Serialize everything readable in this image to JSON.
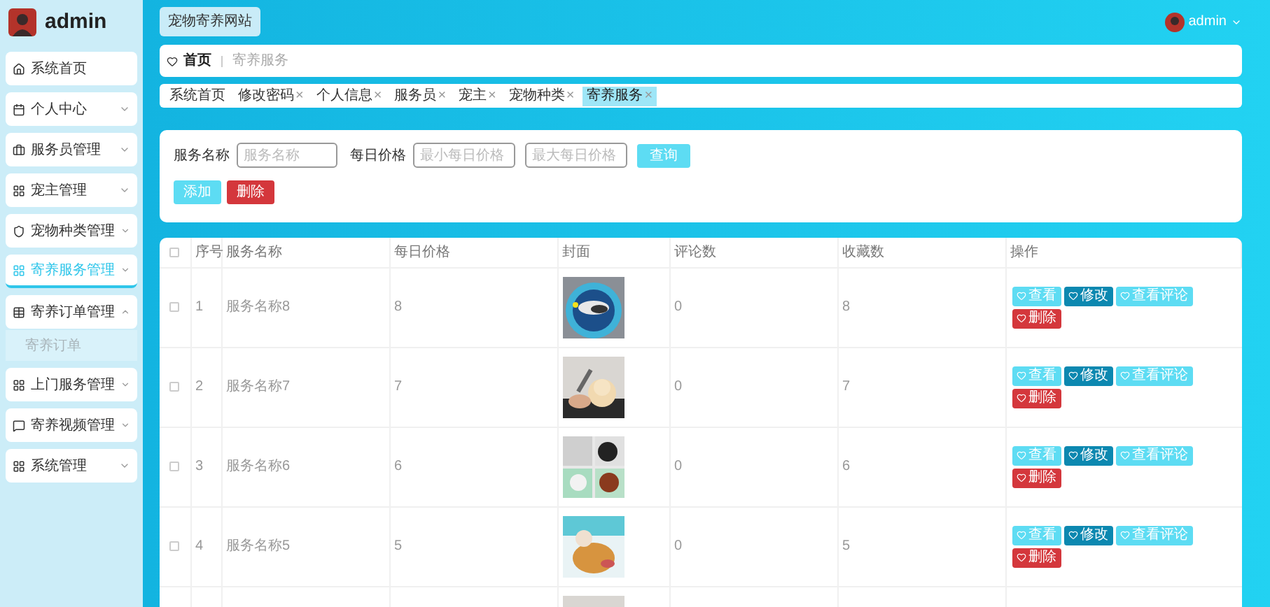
{
  "sidebar": {
    "user": "admin",
    "items": [
      {
        "label": "系统首页",
        "expandable": false,
        "selected": false
      },
      {
        "label": "个人中心",
        "expandable": true,
        "selected": false,
        "expanded": false
      },
      {
        "label": "服务员管理",
        "expandable": true,
        "selected": false,
        "expanded": false
      },
      {
        "label": "宠主管理",
        "expandable": true,
        "selected": false,
        "expanded": false
      },
      {
        "label": "宠物种类管理",
        "expandable": true,
        "selected": false,
        "expanded": false
      },
      {
        "label": "寄养服务管理",
        "expandable": true,
        "selected": true,
        "expanded": false
      },
      {
        "label": "寄养订单管理",
        "expandable": true,
        "selected": false,
        "expanded": true,
        "children": [
          {
            "label": "寄养订单",
            "selected": false
          }
        ]
      },
      {
        "label": "上门服务管理",
        "expandable": true,
        "selected": false,
        "expanded": false
      },
      {
        "label": "寄养视频管理",
        "expandable": true,
        "selected": false,
        "expanded": false
      },
      {
        "label": "系统管理",
        "expandable": true,
        "selected": false,
        "expanded": false
      }
    ]
  },
  "header": {
    "site_button": "宠物寄养网站",
    "user": "admin"
  },
  "breadcrumb": [
    "首页",
    "寄养服务"
  ],
  "tabs": [
    {
      "label": "系统首页",
      "closable": false,
      "selected": false
    },
    {
      "label": "修改密码",
      "closable": true,
      "selected": false
    },
    {
      "label": "个人信息",
      "closable": true,
      "selected": false
    },
    {
      "label": "服务员",
      "closable": true,
      "selected": false
    },
    {
      "label": "宠主",
      "closable": true,
      "selected": false
    },
    {
      "label": "宠物种类",
      "closable": true,
      "selected": false
    },
    {
      "label": "寄养服务",
      "closable": true,
      "selected": true
    }
  ],
  "close_mark": "×",
  "search": {
    "name_label": "服务名称",
    "name_placeholder": "服务名称",
    "price_label": "每日价格",
    "min_placeholder": "最小每日价格",
    "max_placeholder": "最大每日价格",
    "search_button": "查询",
    "add_button": "添加",
    "delete_button": "删除"
  },
  "table": {
    "columns": [
      "序号",
      "服务名称",
      "每日价格",
      "封面",
      "评论数",
      "收藏数",
      "操作"
    ],
    "all_checked": false,
    "rows": [
      {
        "index": "1",
        "name": "服务名称8",
        "price": "8",
        "comments": "0",
        "favorites": "8",
        "checked": false,
        "actions": [
          {
            "label": "查看",
            "kind": "view"
          },
          {
            "label": "修改",
            "kind": "edit"
          },
          {
            "label": "查看评论",
            "kind": "view"
          },
          {
            "label": "删除",
            "kind": "delete"
          }
        ]
      },
      {
        "index": "2",
        "name": "服务名称7",
        "price": "7",
        "comments": "0",
        "favorites": "7",
        "checked": false,
        "actions": [
          {
            "label": "查看",
            "kind": "view"
          },
          {
            "label": "修改",
            "kind": "edit"
          },
          {
            "label": "查看评论",
            "kind": "view"
          },
          {
            "label": "删除",
            "kind": "delete"
          }
        ]
      },
      {
        "index": "3",
        "name": "服务名称6",
        "price": "6",
        "comments": "0",
        "favorites": "6",
        "checked": false,
        "actions": [
          {
            "label": "查看",
            "kind": "view"
          },
          {
            "label": "修改",
            "kind": "edit"
          },
          {
            "label": "查看评论",
            "kind": "view"
          },
          {
            "label": "删除",
            "kind": "delete"
          }
        ]
      },
      {
        "index": "4",
        "name": "服务名称5",
        "price": "5",
        "comments": "0",
        "favorites": "5",
        "checked": false,
        "actions": [
          {
            "label": "查看",
            "kind": "view"
          },
          {
            "label": "修改",
            "kind": "edit"
          },
          {
            "label": "查看评论",
            "kind": "view"
          },
          {
            "label": "删除",
            "kind": "delete"
          }
        ]
      }
    ]
  }
}
